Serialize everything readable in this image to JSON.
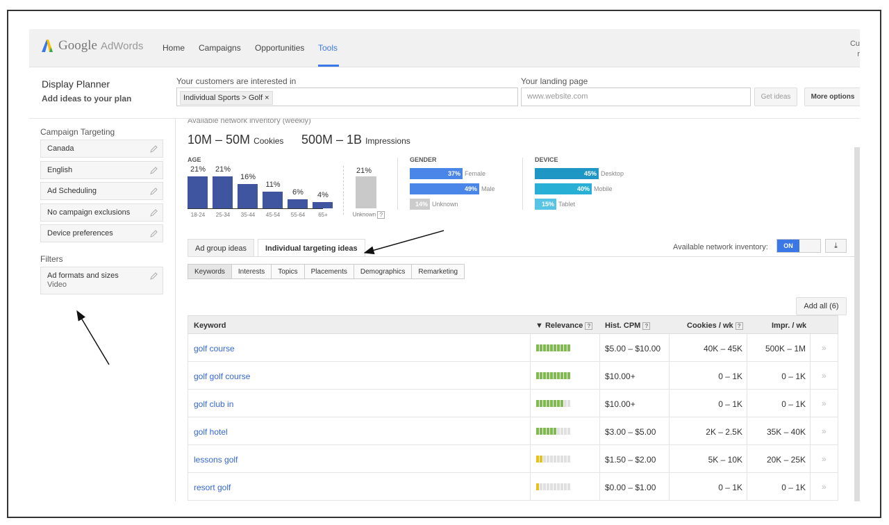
{
  "app": {
    "brand": "Google",
    "product": "AdWords"
  },
  "nav": {
    "items": [
      "Home",
      "Campaigns",
      "Opportunities",
      "Tools"
    ],
    "active": "Tools",
    "user_line1": "Cu",
    "user_line2": "r"
  },
  "planner": {
    "title": "Display Planner",
    "subtitle": "Add ideas to your plan",
    "interest_label": "Your customers are interested in",
    "interest_tag": "Individual Sports > Golf ×",
    "landing_label": "Your landing page",
    "landing_placeholder": "www.website.com",
    "get_ideas": "Get ideas",
    "more_options": "More options"
  },
  "sidebar": {
    "targeting_header": "Campaign Targeting",
    "targeting_items": [
      "Canada",
      "English",
      "Ad Scheduling",
      "No campaign exclusions",
      "Device preferences"
    ],
    "filters_header": "Filters",
    "filter_line1": "Ad formats and sizes",
    "filter_line2": "Video"
  },
  "inventory": {
    "cut_header": "Available network inventory (weekly)",
    "cookies_value": "10M – 50M",
    "cookies_label": "Cookies",
    "impr_value": "500M – 1B",
    "impr_label": "Impressions"
  },
  "age": {
    "label": "AGE",
    "groups": [
      {
        "range": "18-24",
        "pct": 21
      },
      {
        "range": "25-34",
        "pct": 21
      },
      {
        "range": "35-44",
        "pct": 16
      },
      {
        "range": "45-54",
        "pct": 11
      },
      {
        "range": "55-64",
        "pct": 6
      },
      {
        "range": "65+",
        "pct": 4
      }
    ],
    "unknown_pct": 21,
    "unknown_label": "Unknown",
    "pct_labels": [
      "21%",
      "21%",
      "16%",
      "11%",
      "6%",
      "4%"
    ],
    "unknown_pct_label": "21%"
  },
  "gender": {
    "label": "GENDER",
    "rows": [
      {
        "pct": 37,
        "pct_label": "37%",
        "name": "Female",
        "color": "#4a86e8"
      },
      {
        "pct": 49,
        "pct_label": "49%",
        "name": "Male",
        "color": "#4a86e8"
      },
      {
        "pct": 14,
        "pct_label": "14%",
        "name": "Unknown",
        "color": "#cccccc"
      }
    ]
  },
  "device": {
    "label": "DEVICE",
    "rows": [
      {
        "pct": 45,
        "pct_label": "45%",
        "name": "Desktop",
        "color": "#1f97c4"
      },
      {
        "pct": 40,
        "pct_label": "40%",
        "name": "Mobile",
        "color": "#27afd6"
      },
      {
        "pct": 15,
        "pct_label": "15%",
        "name": "Tablet",
        "color": "#57c4e5"
      }
    ]
  },
  "tabs": {
    "ad_group": "Ad group ideas",
    "individual": "Individual targeting ideas"
  },
  "inventory_toggle": {
    "label": "Available network inventory:",
    "state": "ON",
    "download_icon": "⤓"
  },
  "subtabs": [
    "Keywords",
    "Interests",
    "Topics",
    "Placements",
    "Demographics",
    "Remarketing"
  ],
  "add_all": "Add all (6)",
  "table": {
    "headers": {
      "keyword": "Keyword",
      "relevance": "▼ Relevance",
      "cpm": "Hist. CPM",
      "cookies": "Cookies / wk",
      "impr": "Impr. / wk"
    },
    "rows": [
      {
        "keyword": "golf course",
        "relevance": 10,
        "cpm": "$5.00 – $10.00",
        "cookies": "40K – 45K",
        "impr": "500K – 1M"
      },
      {
        "keyword": "golf golf course",
        "relevance": 10,
        "cpm": "$10.00+",
        "cookies": "0 – 1K",
        "impr": "0 – 1K"
      },
      {
        "keyword": "golf club in",
        "relevance": 8,
        "cpm": "$10.00+",
        "cookies": "0 – 1K",
        "impr": "0 – 1K"
      },
      {
        "keyword": "golf hotel",
        "relevance": 6,
        "cpm": "$3.00 – $5.00",
        "cookies": "2K – 2.5K",
        "impr": "35K – 40K"
      },
      {
        "keyword": "lessons golf",
        "relevance": 2,
        "cpm": "$1.50 – $2.00",
        "cookies": "5K – 10K",
        "impr": "20K – 25K"
      },
      {
        "keyword": "resort golf",
        "relevance": 1,
        "cpm": "$0.00 – $1.00",
        "cookies": "0 – 1K",
        "impr": "0 – 1K"
      }
    ],
    "row_chevron": "»"
  },
  "help_mark": "?"
}
